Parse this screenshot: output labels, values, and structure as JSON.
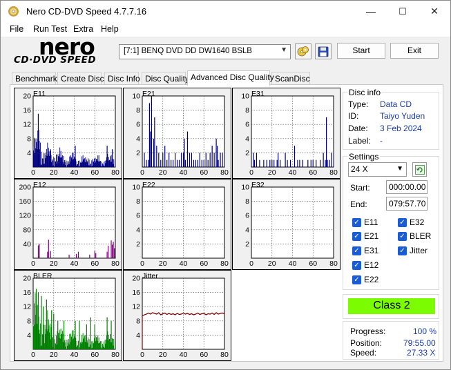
{
  "window": {
    "title": "Nero CD-DVD Speed 4.7.7.16",
    "buttons": {
      "minimize": "—",
      "maximize": "☐",
      "close": "✕"
    }
  },
  "menu": [
    "File",
    "Run Test",
    "Extra",
    "Help"
  ],
  "logo": {
    "top": "nero",
    "bottom": "CD·DVD SPEED"
  },
  "toolbar": {
    "drive": "[7:1]  BENQ DVD DD DW1640 BSLB",
    "start_label": "Start",
    "exit_label": "Exit"
  },
  "tabs": [
    "Benchmark",
    "Create Disc",
    "Disc Info",
    "Disc Quality",
    "Advanced Disc Quality",
    "ScanDisc"
  ],
  "active_tab": "Advanced Disc Quality",
  "disc_info": {
    "title": "Disc info",
    "type_label": "Type:",
    "type": "Data CD",
    "id_label": "ID:",
    "id": "Taiyo Yuden",
    "date_label": "Date:",
    "date": "3 Feb 2024",
    "label_label": "Label:",
    "label": "-"
  },
  "settings": {
    "title": "Settings",
    "speed": "24 X",
    "start_label": "Start:",
    "start": "000:00.00",
    "end_label": "End:",
    "end": "079:57.70",
    "checks": [
      {
        "label": "E11",
        "checked": true
      },
      {
        "label": "E32",
        "checked": true
      },
      {
        "label": "E21",
        "checked": true
      },
      {
        "label": "BLER",
        "checked": true
      },
      {
        "label": "E31",
        "checked": true
      },
      {
        "label": "Jitter",
        "checked": true
      },
      {
        "label": "E12",
        "checked": true
      },
      {
        "label": "E22",
        "checked": true
      }
    ]
  },
  "class": "Class 2",
  "progress": {
    "progress_label": "Progress:",
    "progress": "100 %",
    "position_label": "Position:",
    "position": "79:55.00",
    "speed_label": "Speed:",
    "speed": "27.33 X"
  },
  "chart_data": [
    {
      "type": "bar",
      "title": "E11",
      "yticks": [
        "20",
        "16",
        "12",
        "8",
        "4"
      ],
      "xticks": [
        "0",
        "20",
        "40",
        "60",
        "80"
      ],
      "ylim": [
        0,
        20
      ],
      "xlim": [
        0,
        80
      ],
      "color": "#000080",
      "profile": [
        [
          0,
          8
        ],
        [
          2,
          6
        ],
        [
          4,
          7
        ],
        [
          5,
          9
        ],
        [
          6,
          12
        ],
        [
          8,
          6
        ],
        [
          10,
          5
        ],
        [
          12,
          4
        ],
        [
          14,
          5
        ],
        [
          16,
          4
        ],
        [
          18,
          3
        ],
        [
          20,
          4
        ],
        [
          22,
          5
        ],
        [
          24,
          3
        ],
        [
          26,
          4
        ],
        [
          28,
          3
        ],
        [
          30,
          3
        ],
        [
          32,
          3
        ],
        [
          34,
          2
        ],
        [
          36,
          3
        ],
        [
          38,
          3
        ],
        [
          40,
          3
        ],
        [
          42,
          2
        ],
        [
          44,
          3
        ],
        [
          46,
          2
        ],
        [
          48,
          3
        ],
        [
          50,
          2
        ],
        [
          52,
          2
        ],
        [
          54,
          3
        ],
        [
          56,
          2
        ],
        [
          58,
          3
        ],
        [
          60,
          2
        ],
        [
          62,
          2
        ],
        [
          64,
          3
        ],
        [
          66,
          2
        ],
        [
          68,
          2
        ],
        [
          70,
          2
        ],
        [
          72,
          3
        ],
        [
          74,
          2
        ],
        [
          76,
          3
        ],
        [
          78,
          4
        ],
        [
          79,
          2
        ]
      ],
      "spikes": [
        [
          5,
          15
        ],
        [
          17,
          5
        ],
        [
          41,
          6
        ],
        [
          72,
          6
        ],
        [
          77,
          5
        ]
      ]
    },
    {
      "type": "bar",
      "title": "E21",
      "yticks": [
        "10",
        "8",
        "6",
        "4",
        "2"
      ],
      "xticks": [
        "0",
        "20",
        "40",
        "60",
        "80"
      ],
      "ylim": [
        0,
        10
      ],
      "xlim": [
        0,
        80
      ],
      "color": "#000080",
      "profile": [],
      "spikes": [
        [
          2,
          2
        ],
        [
          4,
          1
        ],
        [
          6,
          1
        ],
        [
          7,
          9
        ],
        [
          8,
          5
        ],
        [
          9,
          10
        ],
        [
          11,
          4
        ],
        [
          12,
          7
        ],
        [
          14,
          3
        ],
        [
          16,
          2
        ],
        [
          18,
          1
        ],
        [
          20,
          2
        ],
        [
          22,
          3
        ],
        [
          24,
          1
        ],
        [
          26,
          2
        ],
        [
          28,
          1
        ],
        [
          30,
          1
        ],
        [
          32,
          2
        ],
        [
          34,
          1
        ],
        [
          36,
          1
        ],
        [
          38,
          2
        ],
        [
          40,
          2
        ],
        [
          41,
          4
        ],
        [
          42,
          1
        ],
        [
          44,
          5
        ],
        [
          46,
          2
        ],
        [
          48,
          2
        ],
        [
          50,
          1
        ],
        [
          52,
          1
        ],
        [
          54,
          1
        ],
        [
          56,
          2
        ],
        [
          58,
          1
        ],
        [
          60,
          1
        ],
        [
          62,
          2
        ],
        [
          64,
          1
        ],
        [
          66,
          2
        ],
        [
          68,
          3
        ],
        [
          70,
          2
        ],
        [
          72,
          4
        ],
        [
          73,
          3
        ],
        [
          74,
          1
        ],
        [
          76,
          2
        ],
        [
          78,
          2
        ]
      ]
    },
    {
      "type": "bar",
      "title": "E31",
      "yticks": [
        "10",
        "8",
        "6",
        "4",
        "2"
      ],
      "xticks": [
        "0",
        "20",
        "40",
        "60",
        "80"
      ],
      "ylim": [
        0,
        10
      ],
      "xlim": [
        0,
        80
      ],
      "color": "#000080",
      "profile": [],
      "spikes": [
        [
          2,
          2
        ],
        [
          3,
          1
        ],
        [
          5,
          2
        ],
        [
          8,
          1
        ],
        [
          12,
          1
        ],
        [
          15,
          1
        ],
        [
          18,
          1
        ],
        [
          20,
          1
        ],
        [
          22,
          1
        ],
        [
          25,
          1
        ],
        [
          26,
          2
        ],
        [
          28,
          1
        ],
        [
          33,
          2
        ],
        [
          35,
          1
        ],
        [
          38,
          1
        ],
        [
          42,
          3
        ],
        [
          45,
          1
        ],
        [
          47,
          1
        ],
        [
          50,
          1
        ],
        [
          55,
          1
        ],
        [
          58,
          1
        ],
        [
          60,
          1
        ],
        [
          63,
          1
        ],
        [
          67,
          1
        ],
        [
          70,
          2
        ],
        [
          72,
          1
        ],
        [
          73,
          7
        ],
        [
          74,
          1
        ],
        [
          76,
          1
        ],
        [
          78,
          2
        ]
      ]
    },
    {
      "type": "bar",
      "title": "E12",
      "yticks": [
        "200",
        "160",
        "120",
        "80",
        "40"
      ],
      "xticks": [
        "0",
        "20",
        "40",
        "60",
        "80"
      ],
      "ylim": [
        0,
        200
      ],
      "xlim": [
        0,
        80
      ],
      "color": "#800080",
      "profile": [],
      "spikes": [
        [
          5,
          36
        ],
        [
          6,
          40
        ],
        [
          14,
          18
        ],
        [
          15,
          52
        ],
        [
          17,
          20
        ],
        [
          35,
          10
        ],
        [
          42,
          12
        ],
        [
          44,
          18
        ],
        [
          55,
          10
        ],
        [
          60,
          20
        ],
        [
          61,
          14
        ],
        [
          72,
          18
        ],
        [
          73,
          35
        ],
        [
          76,
          50
        ],
        [
          77,
          38
        ],
        [
          78,
          46
        ],
        [
          79,
          28
        ]
      ]
    },
    {
      "type": "bar",
      "title": "E22",
      "yticks": [
        "10",
        "8",
        "6",
        "4",
        "2"
      ],
      "xticks": [
        "0",
        "20",
        "40",
        "60",
        "80"
      ],
      "ylim": [
        0,
        10
      ],
      "xlim": [
        0,
        80
      ],
      "color": "#800080",
      "profile": [],
      "spikes": []
    },
    {
      "type": "bar",
      "title": "E32",
      "yticks": [
        "10",
        "8",
        "6",
        "4",
        "2"
      ],
      "xticks": [
        "0",
        "20",
        "40",
        "60",
        "80"
      ],
      "ylim": [
        0,
        10
      ],
      "xlim": [
        0,
        80
      ],
      "color": "#800080",
      "profile": [],
      "spikes": []
    },
    {
      "type": "bar",
      "title": "BLER",
      "yticks": [
        "20",
        "16",
        "12",
        "8",
        "4"
      ],
      "xticks": [
        "0",
        "20",
        "40",
        "60",
        "80"
      ],
      "ylim": [
        0,
        20
      ],
      "xlim": [
        0,
        80
      ],
      "color": "#008000",
      "profile": [
        [
          0,
          10
        ],
        [
          2,
          12
        ],
        [
          4,
          10
        ],
        [
          6,
          9
        ],
        [
          8,
          10
        ],
        [
          10,
          9
        ],
        [
          12,
          7
        ],
        [
          14,
          8
        ],
        [
          16,
          6
        ],
        [
          18,
          6
        ],
        [
          20,
          5
        ],
        [
          22,
          5
        ],
        [
          24,
          5
        ],
        [
          26,
          4
        ],
        [
          28,
          5
        ],
        [
          30,
          4
        ],
        [
          32,
          4
        ],
        [
          34,
          4
        ],
        [
          36,
          4
        ],
        [
          38,
          4
        ],
        [
          40,
          4
        ],
        [
          42,
          3
        ],
        [
          44,
          4
        ],
        [
          46,
          3
        ],
        [
          48,
          4
        ],
        [
          50,
          3
        ],
        [
          52,
          3
        ],
        [
          54,
          4
        ],
        [
          56,
          3
        ],
        [
          58,
          3
        ],
        [
          60,
          3
        ],
        [
          62,
          3
        ],
        [
          64,
          3
        ],
        [
          66,
          3
        ],
        [
          68,
          3
        ],
        [
          70,
          3
        ],
        [
          72,
          4
        ],
        [
          74,
          3
        ],
        [
          76,
          4
        ],
        [
          78,
          5
        ],
        [
          79,
          3
        ]
      ],
      "spikes": [
        [
          3,
          17
        ],
        [
          5,
          16
        ],
        [
          8,
          15
        ],
        [
          10,
          12
        ],
        [
          13,
          14
        ],
        [
          18,
          11
        ],
        [
          20,
          10
        ],
        [
          24,
          8
        ],
        [
          30,
          8
        ],
        [
          41,
          8
        ],
        [
          45,
          8
        ],
        [
          52,
          7
        ],
        [
          56,
          9
        ],
        [
          60,
          7
        ],
        [
          72,
          9
        ],
        [
          76,
          8
        ]
      ]
    },
    {
      "type": "line",
      "title": "Jitter",
      "yticks": [
        "20",
        "16",
        "12",
        "8",
        "4"
      ],
      "xticks": [
        "0",
        "20",
        "40",
        "60",
        "80"
      ],
      "ylim": [
        0,
        20
      ],
      "xlim": [
        0,
        80
      ],
      "color": "#800000",
      "points": [
        [
          0,
          9.4
        ],
        [
          2,
          9.7
        ],
        [
          4,
          9.9
        ],
        [
          6,
          10.2
        ],
        [
          8,
          9.9
        ],
        [
          10,
          10.3
        ],
        [
          12,
          10.1
        ],
        [
          14,
          9.9
        ],
        [
          16,
          10.3
        ],
        [
          18,
          9.7
        ],
        [
          20,
          10.0
        ],
        [
          22,
          10.2
        ],
        [
          24,
          9.8
        ],
        [
          26,
          10.1
        ],
        [
          28,
          9.8
        ],
        [
          30,
          10.0
        ],
        [
          32,
          9.7
        ],
        [
          34,
          10.1
        ],
        [
          36,
          9.8
        ],
        [
          38,
          9.9
        ],
        [
          40,
          10.2
        ],
        [
          42,
          9.9
        ],
        [
          44,
          10.1
        ],
        [
          46,
          9.8
        ],
        [
          48,
          10.0
        ],
        [
          50,
          9.7
        ],
        [
          52,
          9.9
        ],
        [
          54,
          10.2
        ],
        [
          56,
          9.8
        ],
        [
          58,
          10.0
        ],
        [
          60,
          10.1
        ],
        [
          62,
          9.7
        ],
        [
          64,
          10.0
        ],
        [
          66,
          9.9
        ],
        [
          68,
          10.2
        ],
        [
          70,
          9.8
        ],
        [
          72,
          10.3
        ],
        [
          74,
          9.9
        ],
        [
          76,
          10.1
        ],
        [
          78,
          10.2
        ],
        [
          80,
          10.0
        ]
      ]
    }
  ]
}
